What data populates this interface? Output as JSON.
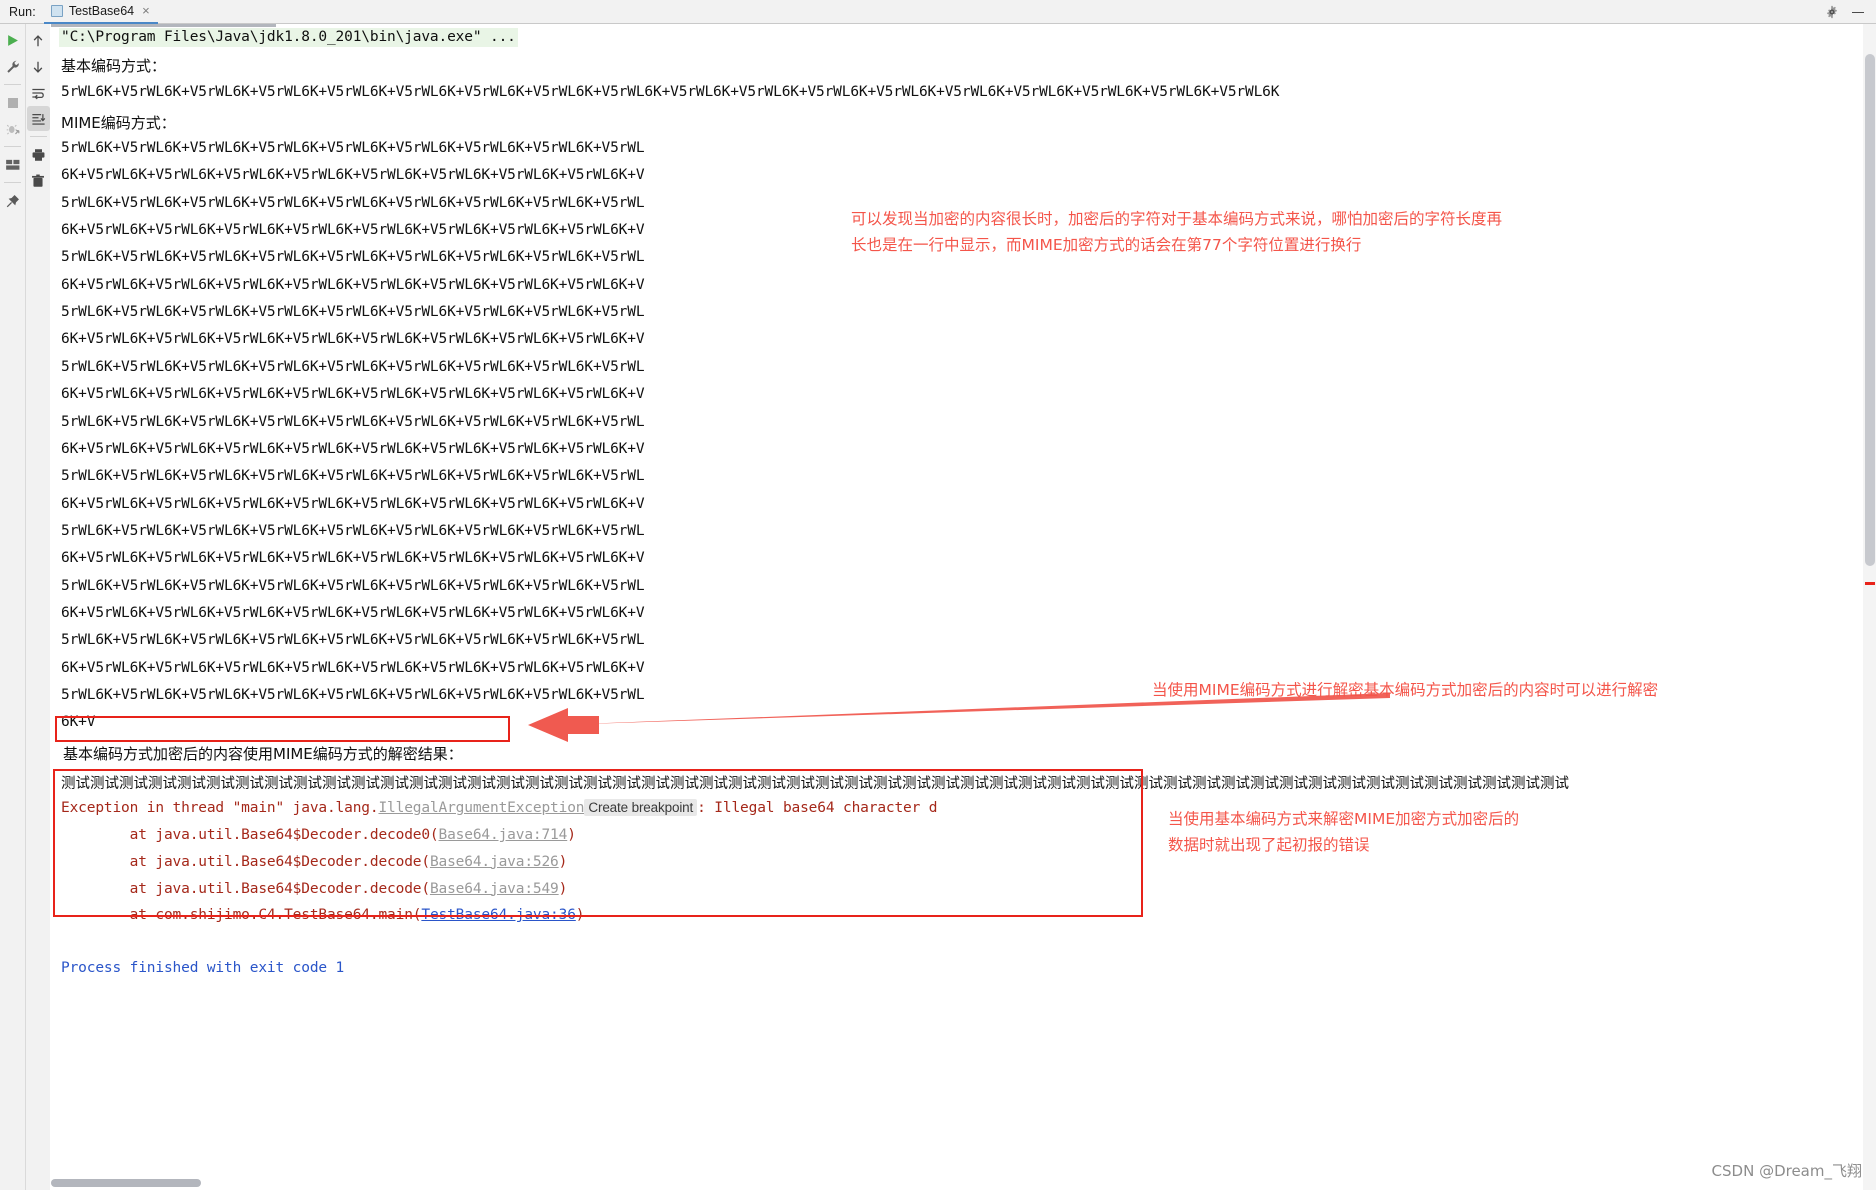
{
  "window": {
    "run_label": "Run:",
    "tab_title": "TestBase64",
    "tab_close": "×",
    "settings_icon": "gear-icon",
    "minimize_icon": "minimize-icon"
  },
  "left_toolbar": {
    "primary": [
      {
        "name": "rerun-button",
        "icon": "play-icon",
        "title": "Rerun"
      },
      {
        "name": "edit-configurations-button",
        "icon": "wrench-icon",
        "title": "Edit Configurations"
      },
      {
        "name": "stop-button",
        "icon": "stop-square-icon",
        "title": "Stop"
      },
      {
        "name": "dump-threads-button",
        "icon": "bug-arrow-icon",
        "title": "Dump Threads"
      },
      {
        "name": "restore-layout-button",
        "icon": "layout-icon",
        "title": "Restore Layout"
      },
      {
        "name": "pin-tab-button",
        "icon": "pin-icon",
        "title": "Pin Tab"
      }
    ],
    "secondary": [
      {
        "name": "up-the-stack-trace-button",
        "icon": "arrow-up-icon",
        "title": "Up the Stack Trace"
      },
      {
        "name": "down-the-stack-trace-button",
        "icon": "arrow-down-icon",
        "title": "Down the Stack Trace"
      },
      {
        "name": "soft-wrap-button",
        "icon": "soft-wrap-icon",
        "title": "Soft-Wrap"
      },
      {
        "name": "scroll-to-end-button",
        "icon": "scroll-to-end-icon",
        "title": "Scroll to the end",
        "selected": true
      },
      {
        "name": "print-button",
        "icon": "printer-icon",
        "title": "Print"
      },
      {
        "name": "clear-all-button",
        "icon": "trash-icon",
        "title": "Clear All"
      }
    ]
  },
  "console": {
    "command_line": "\"C:\\Program Files\\Java\\jdk1.8.0_201\\bin\\java.exe\" ...",
    "basic_label": "基本编码方式：",
    "basic_output": "5rWL6K+V5rWL6K+V5rWL6K+V5rWL6K+V5rWL6K+V5rWL6K+V5rWL6K+V5rWL6K+V5rWL6K+V5rWL6K+V5rWL6K+V5rWL6K+V5rWL6K+V5rWL6K+V5rWL6K+V5rWL6K+V5rWL6K+V5rWL6K",
    "mime_label": "MIME编码方式：",
    "mime_lines": [
      "5rWL6K+V5rWL6K+V5rWL6K+V5rWL6K+V5rWL6K+V5rWL6K+V5rWL6K+V5rWL6K+V5rWL",
      "6K+V5rWL6K+V5rWL6K+V5rWL6K+V5rWL6K+V5rWL6K+V5rWL6K+V5rWL6K+V5rWL6K+V",
      "5rWL6K+V5rWL6K+V5rWL6K+V5rWL6K+V5rWL6K+V5rWL6K+V5rWL6K+V5rWL6K+V5rWL",
      "6K+V5rWL6K+V5rWL6K+V5rWL6K+V5rWL6K+V5rWL6K+V5rWL6K+V5rWL6K+V5rWL6K+V",
      "5rWL6K+V5rWL6K+V5rWL6K+V5rWL6K+V5rWL6K+V5rWL6K+V5rWL6K+V5rWL6K+V5rWL",
      "6K+V5rWL6K+V5rWL6K+V5rWL6K+V5rWL6K+V5rWL6K+V5rWL6K+V5rWL6K+V5rWL6K+V",
      "5rWL6K+V5rWL6K+V5rWL6K+V5rWL6K+V5rWL6K+V5rWL6K+V5rWL6K+V5rWL6K+V5rWL",
      "6K+V5rWL6K+V5rWL6K+V5rWL6K+V5rWL6K+V5rWL6K+V5rWL6K+V5rWL6K+V5rWL6K+V",
      "5rWL6K+V5rWL6K+V5rWL6K+V5rWL6K+V5rWL6K+V5rWL6K+V5rWL6K+V5rWL6K+V5rWL",
      "6K+V5rWL6K+V5rWL6K+V5rWL6K+V5rWL6K+V5rWL6K+V5rWL6K+V5rWL6K+V5rWL6K+V",
      "5rWL6K+V5rWL6K+V5rWL6K+V5rWL6K+V5rWL6K+V5rWL6K+V5rWL6K+V5rWL6K+V5rWL",
      "6K+V5rWL6K+V5rWL6K+V5rWL6K+V5rWL6K+V5rWL6K+V5rWL6K+V5rWL6K+V5rWL6K+V",
      "5rWL6K+V5rWL6K+V5rWL6K+V5rWL6K+V5rWL6K+V5rWL6K+V5rWL6K+V5rWL6K+V5rWL",
      "6K+V5rWL6K+V5rWL6K+V5rWL6K+V5rWL6K+V5rWL6K+V5rWL6K+V5rWL6K+V5rWL6K+V",
      "5rWL6K+V5rWL6K+V5rWL6K+V5rWL6K+V5rWL6K+V5rWL6K+V5rWL6K+V5rWL6K+V5rWL",
      "6K+V5rWL6K+V5rWL6K+V5rWL6K+V5rWL6K+V5rWL6K+V5rWL6K+V5rWL6K+V5rWL6K+V",
      "5rWL6K+V5rWL6K+V5rWL6K+V5rWL6K+V5rWL6K+V5rWL6K+V5rWL6K+V5rWL6K+V5rWL",
      "6K+V5rWL6K+V5rWL6K+V5rWL6K+V5rWL6K+V5rWL6K+V5rWL6K+V5rWL6K+V5rWL6K+V",
      "5rWL6K+V5rWL6K+V5rWL6K+V5rWL6K+V5rWL6K+V5rWL6K+V5rWL6K+V5rWL6K+V5rWL",
      "6K+V5rWL6K+V5rWL6K+V5rWL6K+V5rWL6K+V5rWL6K+V5rWL6K+V5rWL6K+V5rWL6K+V",
      "5rWL6K+V5rWL6K+V5rWL6K+V5rWL6K+V5rWL6K+V5rWL6K+V5rWL6K+V5rWL6K+V5rWL",
      "6K+V"
    ],
    "decrypt_label": "基本编码方式加密后的内容使用MIME编码方式的解密结果：",
    "decrypt_result": "测试测试测试测试测试测试测试测试测试测试测试测试测试测试测试测试测试测试测试测试测试测试测试测试测试测试测试测试测试测试测试测试测试测试测试测试测试测试测试测试测试测试测试测试测试测试测试测试测试测试测试测试",
    "exception": {
      "head_1": "Exception in thread \"main\" java.lang.",
      "head_link": "IllegalArgumentException",
      "breakpoint_badge": "Create breakpoint",
      "head_2": ": Illegal base64 character d",
      "frames": [
        {
          "prefix": "        at java.util.Base64$Decoder.decode0(",
          "link": "Base64.java:714",
          "suffix": ")",
          "link_style": "gray"
        },
        {
          "prefix": "        at java.util.Base64$Decoder.decode(",
          "link": "Base64.java:526",
          "suffix": ")",
          "link_style": "gray"
        },
        {
          "prefix": "        at java.util.Base64$Decoder.decode(",
          "link": "Base64.java:549",
          "suffix": ")",
          "link_style": "gray"
        },
        {
          "prefix": "        at com.shijimo.C4.TestBase64.main(",
          "link": "TestBase64.java:36",
          "suffix": ")",
          "link_style": "blue"
        }
      ]
    },
    "process_finished": "Process finished with exit code 1"
  },
  "annotations": [
    {
      "name": "annotation-mime-wrapping",
      "text": "可以发现当加密的内容很长时，加密后的字符对于基本编码方式来说，哪怕加密后的字符长度再\n长也是在一行中显示，而MIME加密方式的话会在第77个字符位置进行换行"
    },
    {
      "name": "annotation-mime-decode-ok",
      "text": "当使用MIME编码方式进行解密基本编码方式加密后的内容时可以进行解密"
    },
    {
      "name": "annotation-basic-decode-error",
      "text": "当使用基本编码方式来解密MIME加密方式加密后的\n数据时就出现了起初报的错误"
    }
  ],
  "watermark": "CSDN @Dream_飞翔",
  "colors": {
    "annotation_red": "#f4554a",
    "box_red": "#e8231a",
    "error_text": "#a5281a",
    "link_blue": "#2a55c9",
    "command_bg": "#e9f5e6",
    "tab_underline": "#4a88c7"
  }
}
